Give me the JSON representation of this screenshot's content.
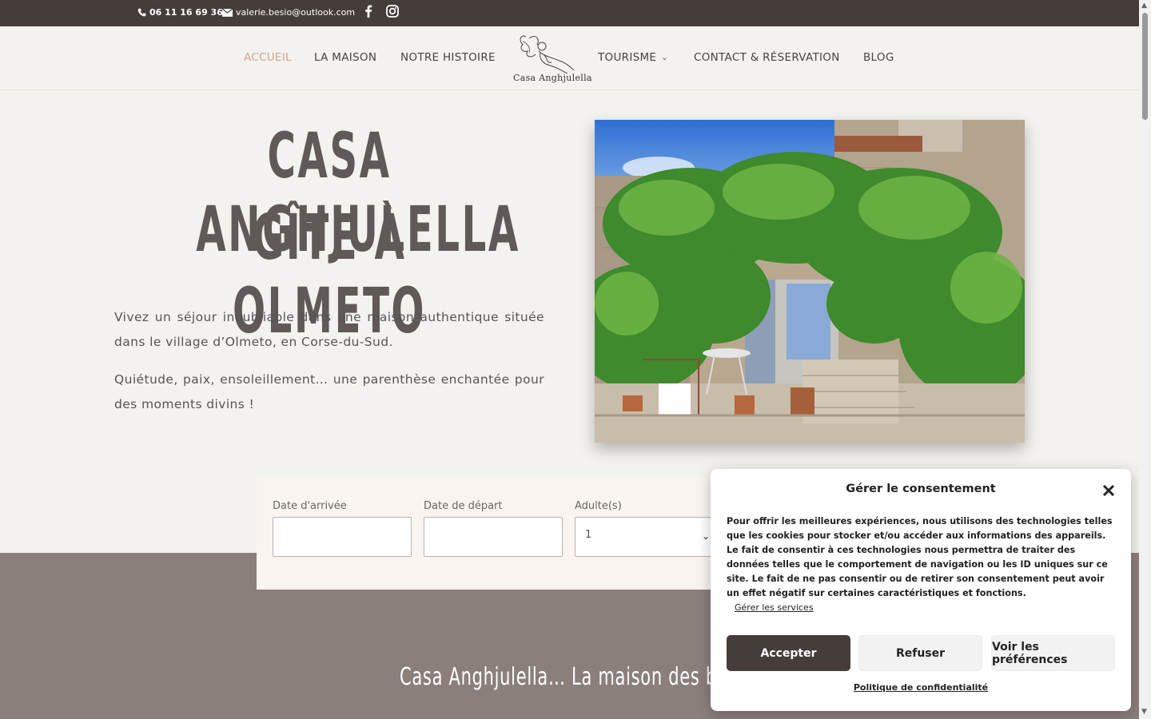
{
  "topbar": {
    "phone": "06 11 16 69 36",
    "email": "valerie.besio@outlook.com",
    "icons": [
      "phone-icon",
      "mail-icon",
      "facebook-icon",
      "instagram-icon"
    ]
  },
  "nav": {
    "items": [
      {
        "label": "ACCUEIL",
        "active": true
      },
      {
        "label": "LA MAISON"
      },
      {
        "label": "NOTRE HISTOIRE"
      },
      {
        "label": "TOURISME",
        "has_dropdown": true
      },
      {
        "label": "CONTACT & RÉSERVATION"
      },
      {
        "label": "BLOG"
      }
    ],
    "logo_text": "Casa Anghjulella"
  },
  "hero": {
    "title_line1": "CASA ANGHJULELLA",
    "title_line2": "GÎTE À OLMETO",
    "paragraph1": "Vivez un séjour inoubliable dans une maison authentique située dans le village d’Olmeto, en Corse-du-Sud.",
    "paragraph2": "Quiétude, paix, ensoleillement… une parenthèse enchantée pour des moments divins !"
  },
  "booking": {
    "arrival_label": "Date d'arrivée",
    "departure_label": "Date de départ",
    "adults_label": "Adulte(s)",
    "adults_value": "1"
  },
  "band": {
    "tagline": "Casa Anghjulella… La maison des beaux jou"
  },
  "consent": {
    "title": "Gérer le consentement",
    "body": "Pour offrir les meilleures expériences, nous utilisons des technologies telles que les cookies pour stocker et/ou accéder aux informations des appareils. Le fait de consentir à ces technologies nous permettra de traiter des données telles que le comportement de navigation ou les ID uniques sur ce site. Le fait de ne pas consentir ou de retirer son consentement peut avoir un effet négatif sur certaines caractéristiques et fonctions.",
    "manage_services": "Gérer les services",
    "accept": "Accepter",
    "refuse": "Refuser",
    "preferences": "Voir les préférences",
    "policy": "Politique de confidentialité"
  },
  "colors": {
    "topbar": "#453d39",
    "accent": "#d4a48c",
    "band": "#8b7f7c",
    "background": "#f4f2ee"
  }
}
